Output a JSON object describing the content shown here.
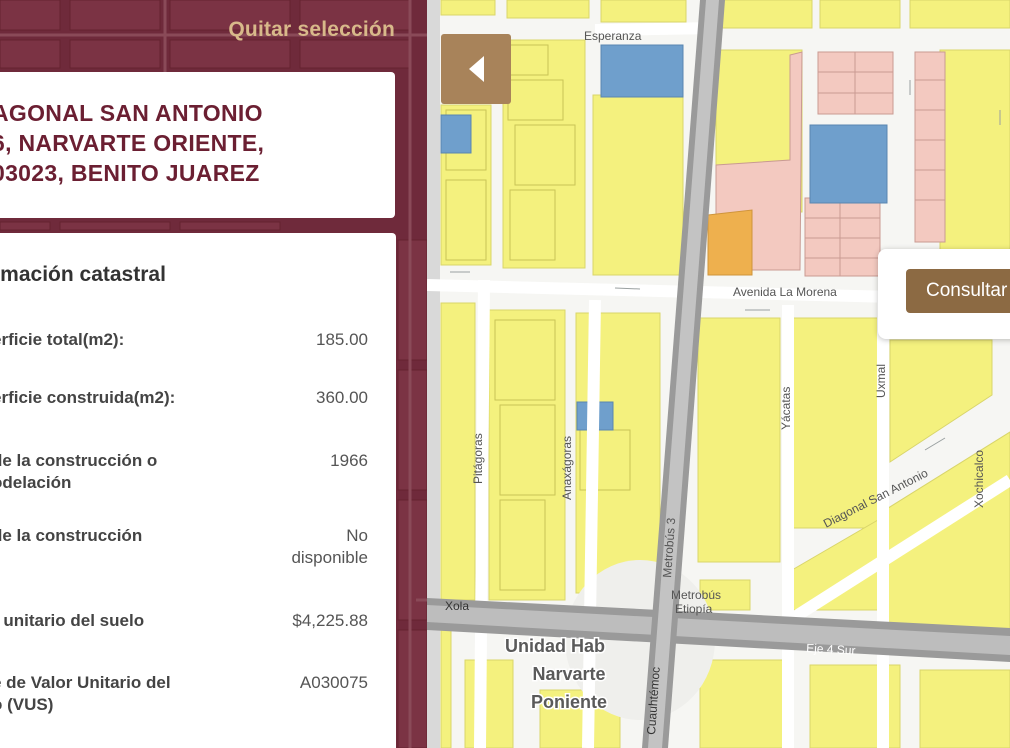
{
  "sidebar": {
    "clear_selection": "Quitar selección",
    "address": {
      "line1": "AGONAL SAN ANTONIO",
      "line2": "6, NARVARTE ORIENTE,",
      "line3": "03023, BENITO JUAREZ"
    },
    "info": {
      "title": "rmación catastral",
      "rows": [
        {
          "label_lines": [
            "erficie total(m2):"
          ],
          "value_lines": [
            "185.00"
          ]
        },
        {
          "label_lines": [
            "erficie construida(m2):"
          ],
          "value_lines": [
            "360.00"
          ]
        },
        {
          "label_lines": [
            "de la construcción o",
            "odelación"
          ],
          "value_lines": [
            "1966"
          ]
        },
        {
          "label_lines": [
            "de la construcción"
          ],
          "value_lines": [
            "No",
            "disponible"
          ]
        },
        {
          "label_lines": [
            "r unitario del suelo"
          ],
          "value_lines": [
            "$4,225.88"
          ]
        },
        {
          "label_lines": [
            "e de Valor Unitario del",
            "o (VUS)"
          ],
          "value_lines": [
            "A030075"
          ]
        }
      ]
    }
  },
  "map": {
    "consult_button": "Consultar",
    "collapse_icon": "chevron-left-icon",
    "streets": {
      "esperanza": "Esperanza",
      "avenida_la_morena": "Avenida  La  Morena",
      "pitagoras": "Pitágoras",
      "anaxagoras": "Anaxágoras",
      "yacatas": "Yácatas",
      "uxmal": "Uxmal",
      "diagonal_san_antonio": "Diagonal  San  Antonio",
      "xochicalco": "Xochicalco",
      "metrobus_3": "Metrobús  3",
      "metrobus_label": "Metrobús",
      "etiopia": "Etiopía",
      "xola": "Xola",
      "eje_4_sur": "Eje 4 Sur",
      "cuauhtemoc": "Cuauhtémoc"
    },
    "neighborhood": {
      "line1": "Unidad Hab",
      "line2": "Narvarte",
      "line3": "Poniente"
    }
  },
  "colors": {
    "panel_bg": "#6f2a3b",
    "accent_text": "#6b1f32",
    "block_yellow": "#f4f17e",
    "block_pink": "#f3c9c0",
    "block_blue": "#6f9fcc",
    "block_orange": "#eeb04e",
    "button_brown": "#8c6a43"
  }
}
